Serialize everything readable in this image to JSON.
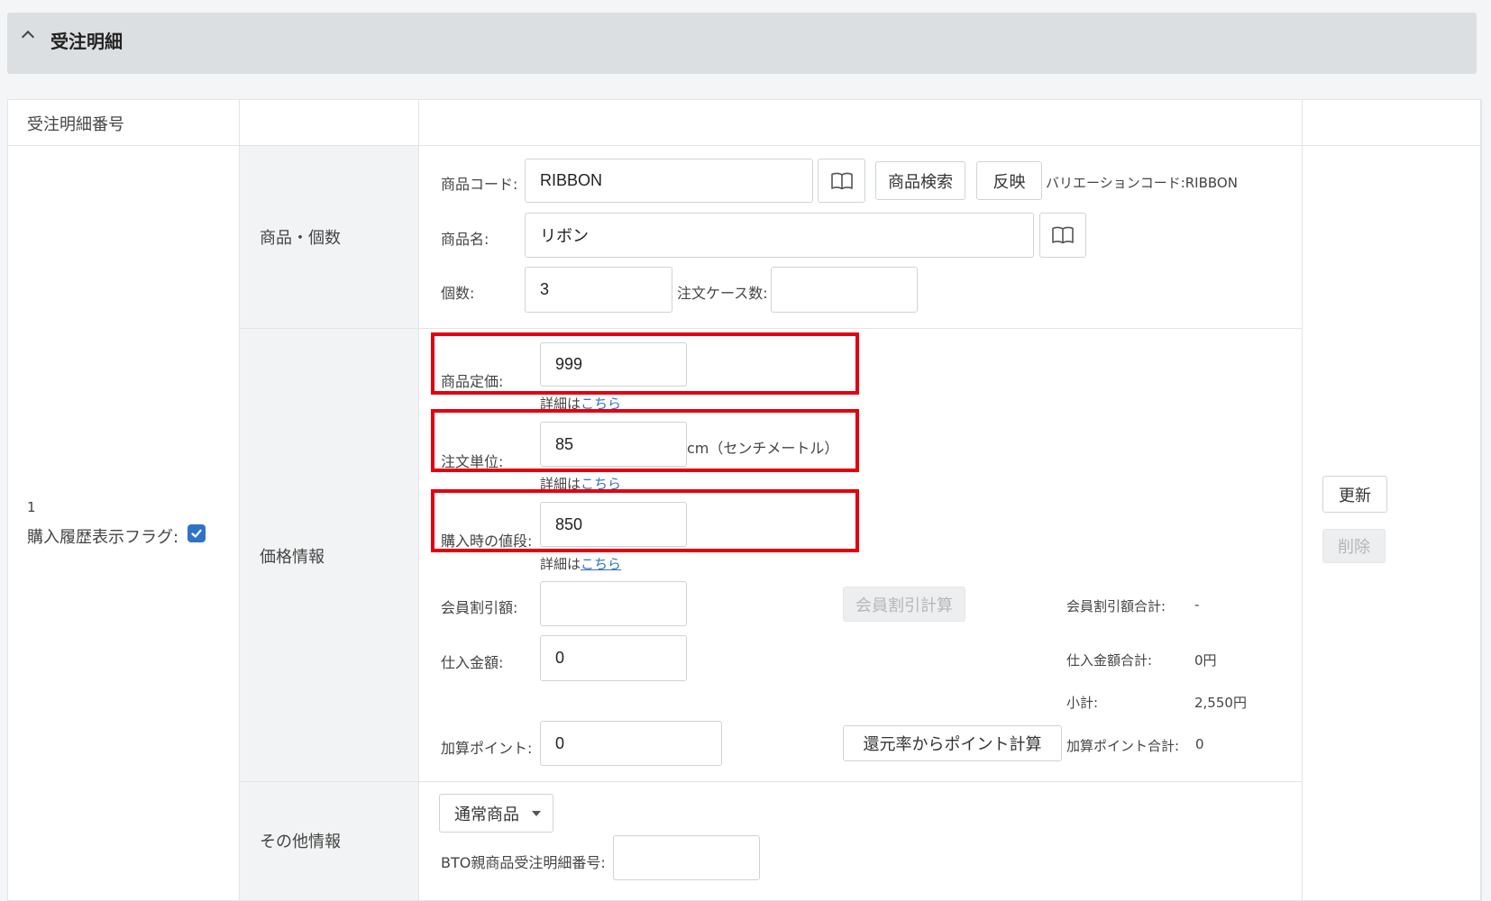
{
  "section": {
    "title": "受注明細"
  },
  "table": {
    "header": {
      "col1": "受注明細番号"
    },
    "row": {
      "number": "1",
      "purchase_history_flag_label": "購入履歴表示フラグ:",
      "purchase_history_flag_checked": true
    }
  },
  "product": {
    "group_label": "商品・個数",
    "code_label": "商品コード:",
    "code_value": "RIBBON",
    "search_button": "商品検索",
    "apply_button": "反映",
    "variation_label": "バリエーションコード:RIBBON",
    "name_label": "商品名:",
    "name_value": "リボン",
    "qty_label": "個数:",
    "qty_value": "3",
    "case_label": "注文ケース数:",
    "case_value": ""
  },
  "price": {
    "group_label": "価格情報",
    "list_price_label": "商品定価:",
    "list_price_value": "999",
    "detail_prefix": "詳細は",
    "detail_link": "こちら",
    "unit_label": "注文単位:",
    "unit_value": "85",
    "unit_suffix": "cm（センチメートル）",
    "purchase_price_label": "購入時の値段:",
    "purchase_price_value": "850",
    "member_discount_label": "会員割引額:",
    "member_discount_value": "",
    "member_discount_calc_button": "会員割引計算",
    "member_discount_total_label": "会員割引額合計:",
    "member_discount_total_value": "-",
    "cost_label": "仕入金額:",
    "cost_value": "0",
    "cost_total_label": "仕入金額合計:",
    "cost_total_value": "0円",
    "subtotal_label": "小計:",
    "subtotal_value": "2,550円",
    "points_label": "加算ポイント:",
    "points_value": "0",
    "points_calc_button": "還元率からポイント計算",
    "points_total_label": "加算ポイント合計:",
    "points_total_value": "0"
  },
  "other": {
    "group_label": "その他情報",
    "product_type_selected": "通常商品",
    "bto_label": "BTO親商品受注明細番号:",
    "bto_value": ""
  },
  "actions": {
    "update_button": "更新",
    "delete_button": "削除"
  },
  "colors": {
    "highlight": "#e3000f",
    "link": "#2f73c8",
    "checkbox": "#2f73c8"
  }
}
